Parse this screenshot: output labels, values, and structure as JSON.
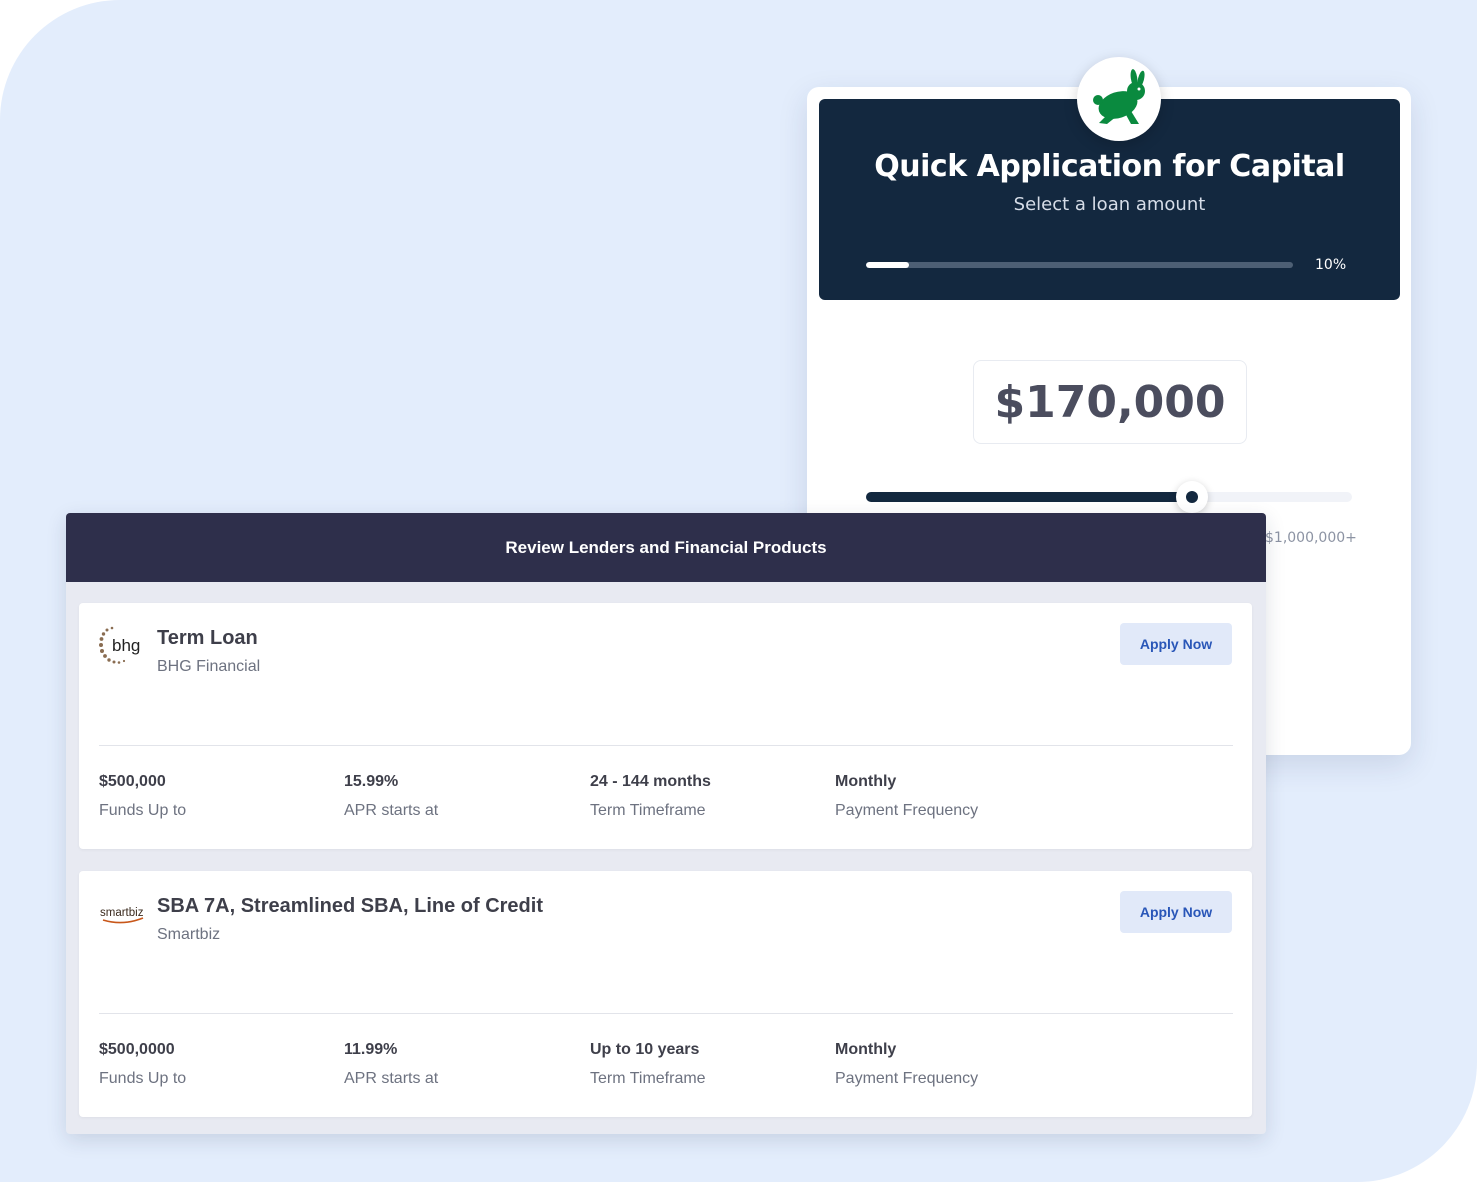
{
  "app_form": {
    "title": "Quick Application for Capital",
    "subtitle": "Select a loan amount",
    "progress_percent": 10,
    "progress_label": "10%",
    "amount": "$170,000",
    "slider_fraction": 0.67,
    "slider_max_label": "$1,000,000+",
    "logo_icon": "rabbit-icon",
    "logo_color": "#0a8a3f"
  },
  "review": {
    "header": "Review Lenders and Financial Products",
    "apply_label": "Apply Now",
    "lenders": [
      {
        "product": "Term Loan",
        "lender": "BHG Financial",
        "logo_text": "bhg",
        "stats": [
          {
            "value": "$500,000",
            "label": "Funds Up to"
          },
          {
            "value": "15.99%",
            "label": "APR starts at"
          },
          {
            "value": "24 - 144 months",
            "label": "Term Timeframe"
          },
          {
            "value": "Monthly",
            "label": "Payment Frequency"
          }
        ]
      },
      {
        "product": "SBA 7A, Streamlined SBA, Line of Credit",
        "lender": "Smartbiz",
        "logo_text": "smartbiz",
        "stats": [
          {
            "value": "$500,0000",
            "label": "Funds Up to"
          },
          {
            "value": "11.99%",
            "label": "APR starts at"
          },
          {
            "value": "Up to 10 years",
            "label": "Term Timeframe"
          },
          {
            "value": "Monthly",
            "label": "Payment Frequency"
          }
        ]
      }
    ]
  },
  "colors": {
    "background": "#e3edfc",
    "app_header": "#13283f",
    "review_header": "#2e2f4b",
    "apply_button_bg": "#e1e9f9",
    "apply_button_text": "#2956b8"
  }
}
